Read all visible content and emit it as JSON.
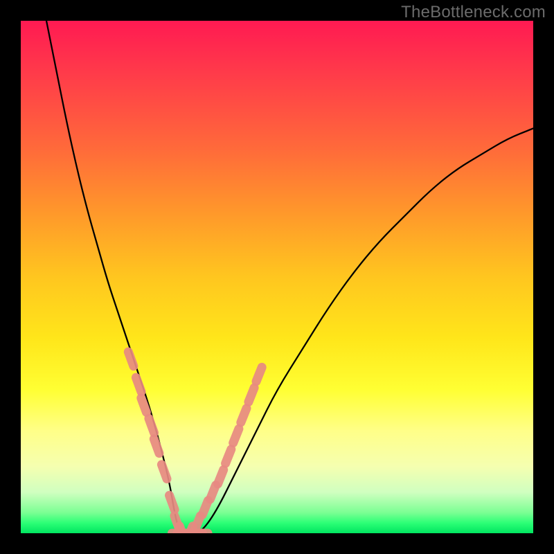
{
  "watermark": "TheBottleneck.com",
  "chart_data": {
    "type": "line",
    "title": "",
    "xlabel": "",
    "ylabel": "",
    "grid": false,
    "legend": false,
    "xlim": [
      0,
      100
    ],
    "ylim": [
      0,
      100
    ],
    "notes": "Bottleneck curve with vertical rainbow gradient background (red top → green bottom). Salmon-colored marker segments overlay portions of both branches of the V-curve near the bottom.",
    "series": [
      {
        "name": "bottleneck-curve",
        "color": "#000000",
        "x": [
          5,
          7,
          9,
          11,
          13,
          15,
          17,
          19,
          21,
          23,
          25,
          27,
          29,
          30,
          31,
          33,
          35,
          38,
          42,
          46,
          50,
          55,
          60,
          65,
          70,
          75,
          80,
          85,
          90,
          95,
          100
        ],
        "y": [
          100,
          90,
          80,
          71,
          63,
          56,
          49,
          43,
          37,
          31,
          25,
          18,
          10,
          4,
          0,
          0,
          0,
          4,
          12,
          20,
          28,
          36,
          44,
          51,
          57,
          62,
          67,
          71,
          74,
          77,
          79
        ]
      },
      {
        "name": "markers-left-branch",
        "type": "scatter",
        "color": "#e88a82",
        "x": [
          21.5,
          23.0,
          24.0,
          25.5,
          26.5,
          28.0,
          29.5,
          30.5,
          31.5
        ],
        "y": [
          34,
          29,
          25,
          21,
          17,
          12,
          6,
          2,
          0
        ]
      },
      {
        "name": "markers-right-branch",
        "type": "scatter",
        "color": "#e88a82",
        "x": [
          33.0,
          34.5,
          36.0,
          37.5,
          39.0,
          40.5,
          42.0,
          43.5,
          45.0,
          46.5
        ],
        "y": [
          0,
          2,
          5,
          8,
          11,
          15,
          19,
          23,
          27,
          31
        ]
      },
      {
        "name": "markers-trough",
        "type": "scatter",
        "color": "#e88a82",
        "x": [
          31.0,
          32.0,
          33.0,
          34.0,
          35.0
        ],
        "y": [
          0,
          0,
          0,
          0,
          0
        ]
      }
    ],
    "background_gradient_stops": [
      {
        "pos": 0,
        "color": "#ff1a52"
      },
      {
        "pos": 25,
        "color": "#ff6a3a"
      },
      {
        "pos": 50,
        "color": "#ffc61f"
      },
      {
        "pos": 72,
        "color": "#ffff33"
      },
      {
        "pos": 92,
        "color": "#d0ffc0"
      },
      {
        "pos": 100,
        "color": "#00e560"
      }
    ]
  }
}
